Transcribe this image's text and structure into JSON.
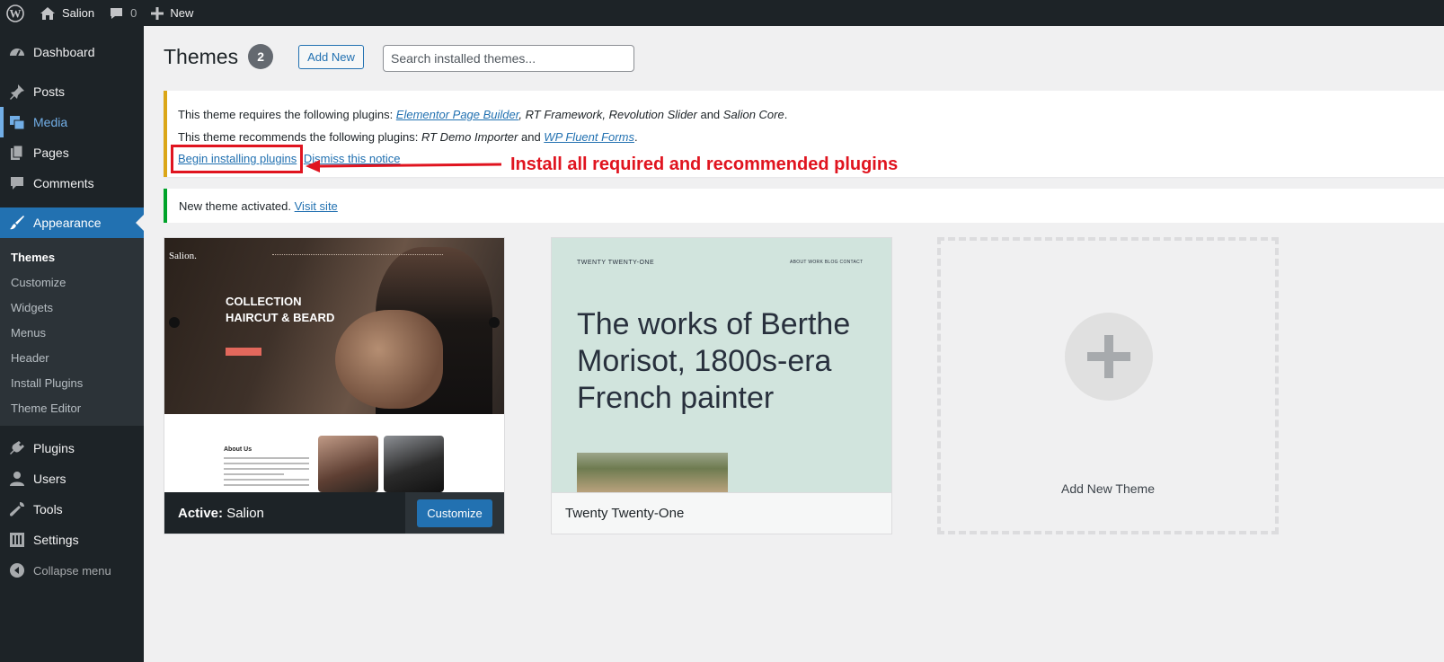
{
  "admin_bar": {
    "site_name": "Salion",
    "comments_count": "0",
    "new_label": "New"
  },
  "sidebar": {
    "items": [
      {
        "label": "Dashboard",
        "icon": "dashboard-icon"
      },
      {
        "label": "Posts",
        "icon": "pin-icon"
      },
      {
        "label": "Media",
        "icon": "media-icon"
      },
      {
        "label": "Pages",
        "icon": "pages-icon"
      },
      {
        "label": "Comments",
        "icon": "comment-icon"
      },
      {
        "label": "Appearance",
        "icon": "brush-icon"
      },
      {
        "label": "Plugins",
        "icon": "plug-icon"
      },
      {
        "label": "Users",
        "icon": "user-icon"
      },
      {
        "label": "Tools",
        "icon": "wrench-icon"
      },
      {
        "label": "Settings",
        "icon": "settings-icon"
      },
      {
        "label": "Collapse menu",
        "icon": "collapse-icon"
      }
    ],
    "submenu": [
      "Themes",
      "Customize",
      "Widgets",
      "Menus",
      "Header",
      "Install Plugins",
      "Theme Editor"
    ]
  },
  "page": {
    "title": "Themes",
    "count": "2",
    "add_new": "Add New",
    "search_placeholder": "Search installed themes..."
  },
  "notice_plugins": {
    "req_prefix": "This theme requires the following plugins: ",
    "req_link": "Elementor Page Builder",
    "req_rest_1": ", ",
    "req_plugin_2": "RT Framework",
    "req_sep_2": ", ",
    "req_plugin_3": "Revolution Slider",
    "req_and": " and ",
    "req_plugin_4": "Salion Core",
    "req_end": ".",
    "rec_prefix": "This theme recommends the following plugins: ",
    "rec_plugin_1": "RT Demo Importer",
    "rec_and": " and ",
    "rec_link": "WP Fluent Forms",
    "rec_end": ".",
    "begin_install": "Begin installing plugins",
    "dismiss": "Dismiss this notice"
  },
  "annotation": "Install all required and recommended plugins",
  "notice_activated": {
    "text": "New theme activated. ",
    "link": "Visit site"
  },
  "themes": [
    {
      "active_label": "Active:",
      "name": "Salion",
      "customize": "Customize",
      "preview_logo": "Salion.",
      "preview_title_1": "COLLECTION",
      "preview_title_2": "HAIRCUT & BEARD",
      "preview_about": "About Us"
    },
    {
      "name": "Twenty Twenty-One",
      "preview_brand": "TWENTY TWENTY-ONE",
      "preview_nav": "ABOUT   WORK   BLOG   CONTACT",
      "preview_heading": "The works of Berthe Morisot, 1800s-era French painter"
    }
  ],
  "add_new_theme": "Add New Theme",
  "colors": {
    "admin_dark": "#1d2327",
    "accent_blue": "#2271b1",
    "warning_border": "#dba617",
    "success_border": "#00a32a",
    "annotation_red": "#e0141f"
  }
}
